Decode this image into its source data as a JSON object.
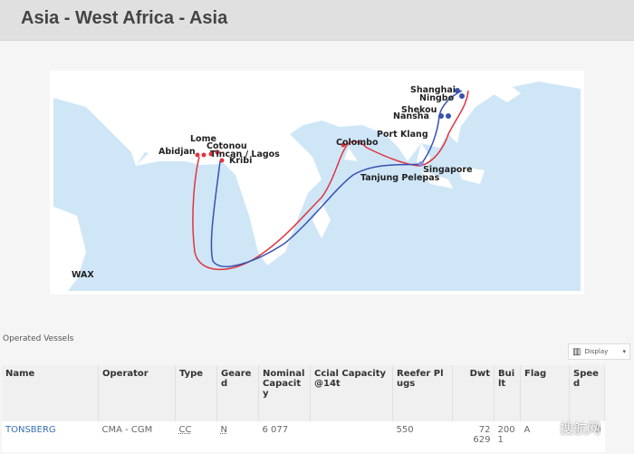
{
  "header": {
    "title": "Asia - West Africa - Asia"
  },
  "map": {
    "service_label": "WAX",
    "ports": [
      "Shanghai",
      "Ningbo",
      "Shekou",
      "Nansha",
      "Port Klang",
      "Colombo",
      "Singapore",
      "Tanjung Pelepas",
      "Lome",
      "Cotonou",
      "Abidjan",
      "Tincan / Lagos",
      "Kribi"
    ],
    "colors": {
      "ocean": "#cfe6f7",
      "land": "#ffffff",
      "route_red": "#e0343f",
      "route_blue": "#3a52b0"
    }
  },
  "vessels": {
    "section_title": "Operated Vessels",
    "display_button": "Display",
    "columns": [
      "Name",
      "Operator",
      "Type",
      "Geared",
      "Nominal Capacity",
      "Ccial Capacity @14t",
      "Reefer Plugs",
      "Dwt",
      "Built",
      "Flag",
      "Speed"
    ],
    "rows": [
      {
        "name": "TONSBERG",
        "operator": "CMA - CGM",
        "type": "CC",
        "geared": "N",
        "nominal": "6 077",
        "ccial": "",
        "reefer": "550",
        "dwt": "72 629",
        "built": "2001",
        "flag": "A",
        "speed": "0"
      }
    ]
  },
  "watermark": "搜航网"
}
